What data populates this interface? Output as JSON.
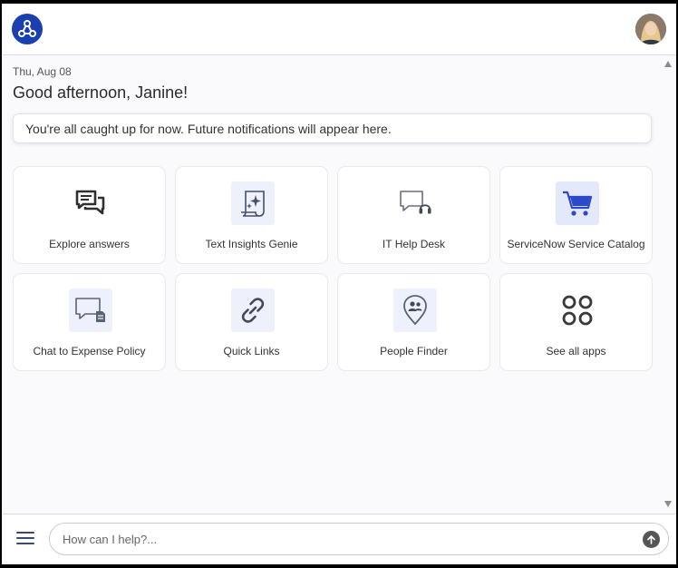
{
  "header": {
    "logo_icon": "network-nodes-icon",
    "avatar_icon": "user-avatar-icon"
  },
  "home": {
    "date": "Thu, Aug 08",
    "greeting": "Good afternoon, Janine!",
    "notification": "You're all caught up for now. Future notifications will appear here."
  },
  "tiles": [
    {
      "label": "Explore answers",
      "icon": "speech-bubbles-icon"
    },
    {
      "label": "Text Insights Genie",
      "icon": "sparkle-scroll-icon"
    },
    {
      "label": "IT Help Desk",
      "icon": "headset-chat-icon"
    },
    {
      "label": "ServiceNow Service Catalog",
      "icon": "shopping-cart-icon"
    },
    {
      "label": "Chat to Expense Policy",
      "icon": "document-chat-icon"
    },
    {
      "label": "Quick Links",
      "icon": "link-icon"
    },
    {
      "label": "People Finder",
      "icon": "people-pin-icon"
    },
    {
      "label": "See all apps",
      "icon": "apps-grid-icon"
    }
  ],
  "composer": {
    "placeholder": "How can I help?...",
    "value": ""
  },
  "colors": {
    "brand": "#1a3fb0",
    "tile_tint": "#eef1fb",
    "cart_blue": "#2b49c9"
  }
}
